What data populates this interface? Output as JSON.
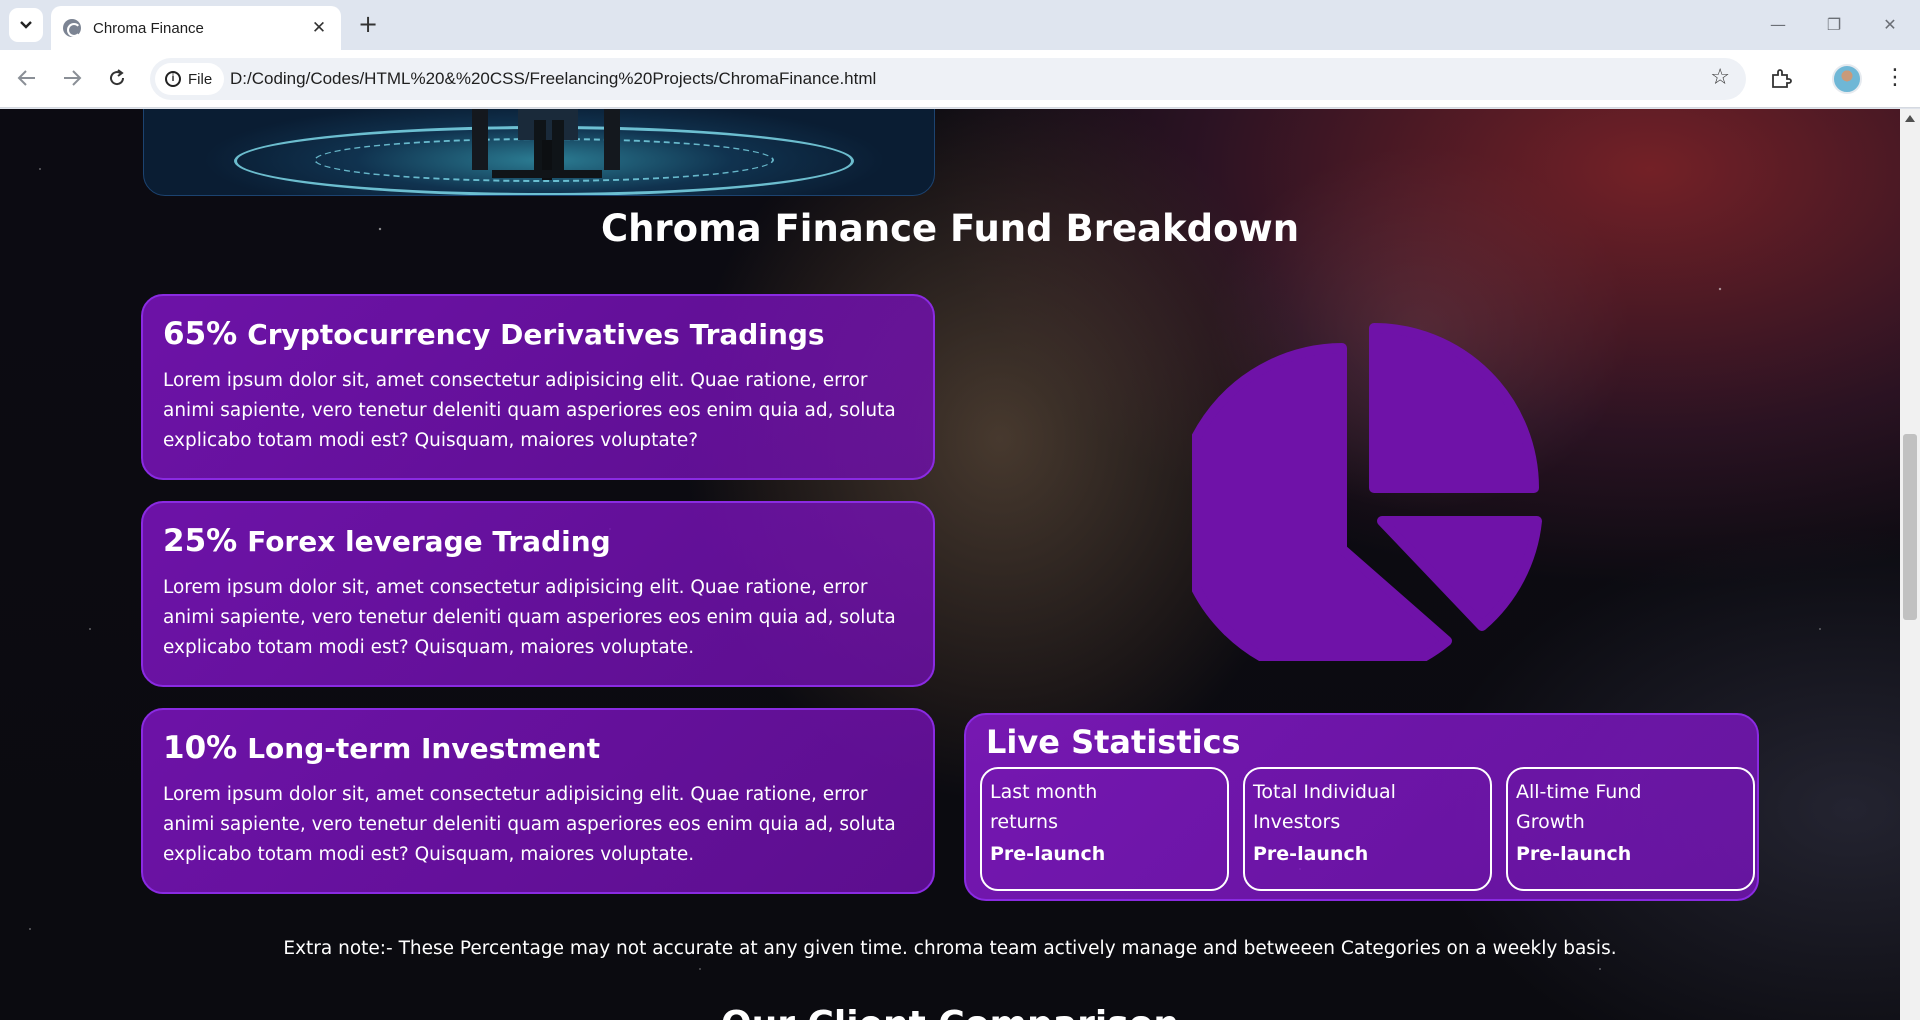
{
  "browser": {
    "tab": {
      "title": "Chroma Finance"
    },
    "address": {
      "chip_label": "File",
      "url": "D:/Coding/Codes/HTML%20&%20CSS/Freelancing%20Projects/ChromaFinance.html"
    }
  },
  "page": {
    "section_title": "Chroma Finance Fund Breakdown",
    "funds": [
      {
        "percent": "65%",
        "name": "Cryptocurrency Derivatives Tradings",
        "description": "Lorem ipsum dolor sit, amet consectetur adipisicing elit. Quae ratione, error animi sapiente, vero tenetur deleniti quam asperiores eos enim quia ad, soluta explicabo totam modi est? Quisquam, maiores voluptate?"
      },
      {
        "percent": "25%",
        "name": "Forex leverage Trading",
        "description": "Lorem ipsum dolor sit, amet consectetur adipisicing elit. Quae ratione, error animi sapiente, vero tenetur deleniti quam asperiores eos enim quia ad, soluta explicabo totam modi est? Quisquam, maiores voluptate."
      },
      {
        "percent": "10%",
        "name": "Long-term Investment",
        "description": "Lorem ipsum dolor sit, amet consectetur adipisicing elit. Quae ratione, error animi sapiente, vero tenetur deleniti quam asperiores eos enim quia ad, soluta explicabo totam modi est? Quisquam, maiores voluptate."
      }
    ],
    "pie_icon": "pie-chart-icon",
    "live_stats": {
      "title": "Live Statistics",
      "items": [
        {
          "label": "Last month returns",
          "value": "Pre-launch"
        },
        {
          "label": "Total Individual Investors",
          "value": "Pre-launch"
        },
        {
          "label": "All-time Fund Growth",
          "value": "Pre-launch"
        }
      ]
    },
    "extra_note": "Extra note:- These Percentage may not accurate at any given time. chroma team actively manage and betweeen Categories on a weekly basis.",
    "next_section_title": "Our Client Comparison"
  },
  "colors": {
    "card_purple": "#8a2be2",
    "pie_purple": "#6f12a8",
    "text": "#ffffff"
  }
}
